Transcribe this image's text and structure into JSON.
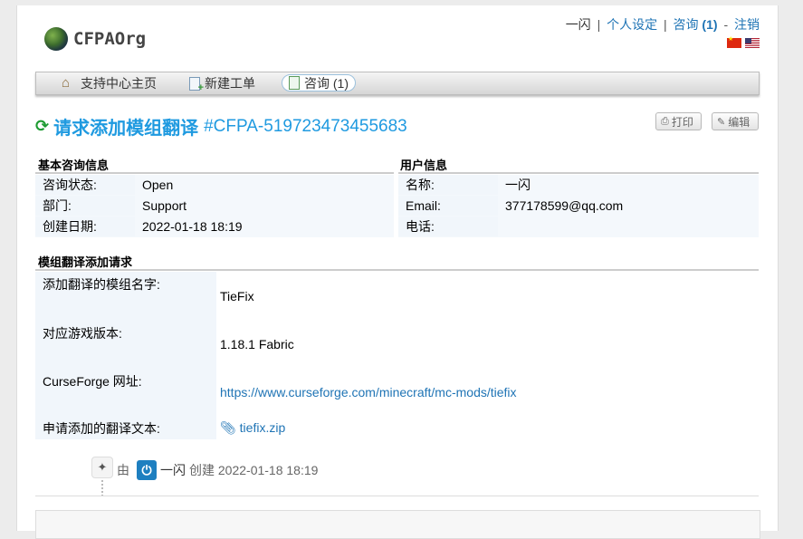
{
  "brand": {
    "name": "CFPAOrg"
  },
  "user_nav": {
    "username": "一闪",
    "settings": "个人设定",
    "tickets": "咨询",
    "tickets_count": "(1)",
    "logout": "注销",
    "sep1": "|",
    "sep2": "|",
    "sep3": "-",
    "languages": [
      "zh-CN flag",
      "en-US flag"
    ]
  },
  "nav": {
    "items": [
      {
        "label": "支持中心主页",
        "icon": "home-icon"
      },
      {
        "label": "新建工单",
        "icon": "new-ticket-icon"
      },
      {
        "label": "咨询 (1)",
        "icon": "ticket-icon",
        "active": true
      }
    ]
  },
  "ticket": {
    "subject": "请求添加模组翻译",
    "number": "#CFPA-519723473455683",
    "print_label": "打印",
    "edit_label": "编辑"
  },
  "basic_info": {
    "title": "基本咨询信息",
    "rows": [
      {
        "label": "咨询状态:",
        "value": "Open"
      },
      {
        "label": "部门:",
        "value": "Support"
      },
      {
        "label": "创建日期:",
        "value": "2022-01-18 18:19"
      }
    ]
  },
  "user_info": {
    "title": "用户信息",
    "rows": [
      {
        "label": "名称:",
        "value": "一闪"
      },
      {
        "label": "Email:",
        "value": "377178599@qq.com"
      },
      {
        "label": "电话:",
        "value": ""
      }
    ]
  },
  "request": {
    "title": "模组翻译添加请求",
    "fields": [
      {
        "label": "添加翻译的模组名字:",
        "value": "TieFix"
      },
      {
        "label": "对应游戏版本:",
        "value": "1.18.1 Fabric"
      },
      {
        "label": "CurseForge 网址:",
        "value": "https://www.curseforge.com/minecraft/mc-mods/tiefix"
      },
      {
        "label": "申请添加的翻译文本:",
        "value": "tiefix.zip"
      }
    ]
  },
  "history": {
    "by": "由",
    "user": "一闪",
    "action": "创建",
    "time": "2022-01-18 18:19"
  },
  "colors": {
    "accent": "#1f9ae0",
    "link": "#1f74b5",
    "refresh": "#1e9b32"
  }
}
